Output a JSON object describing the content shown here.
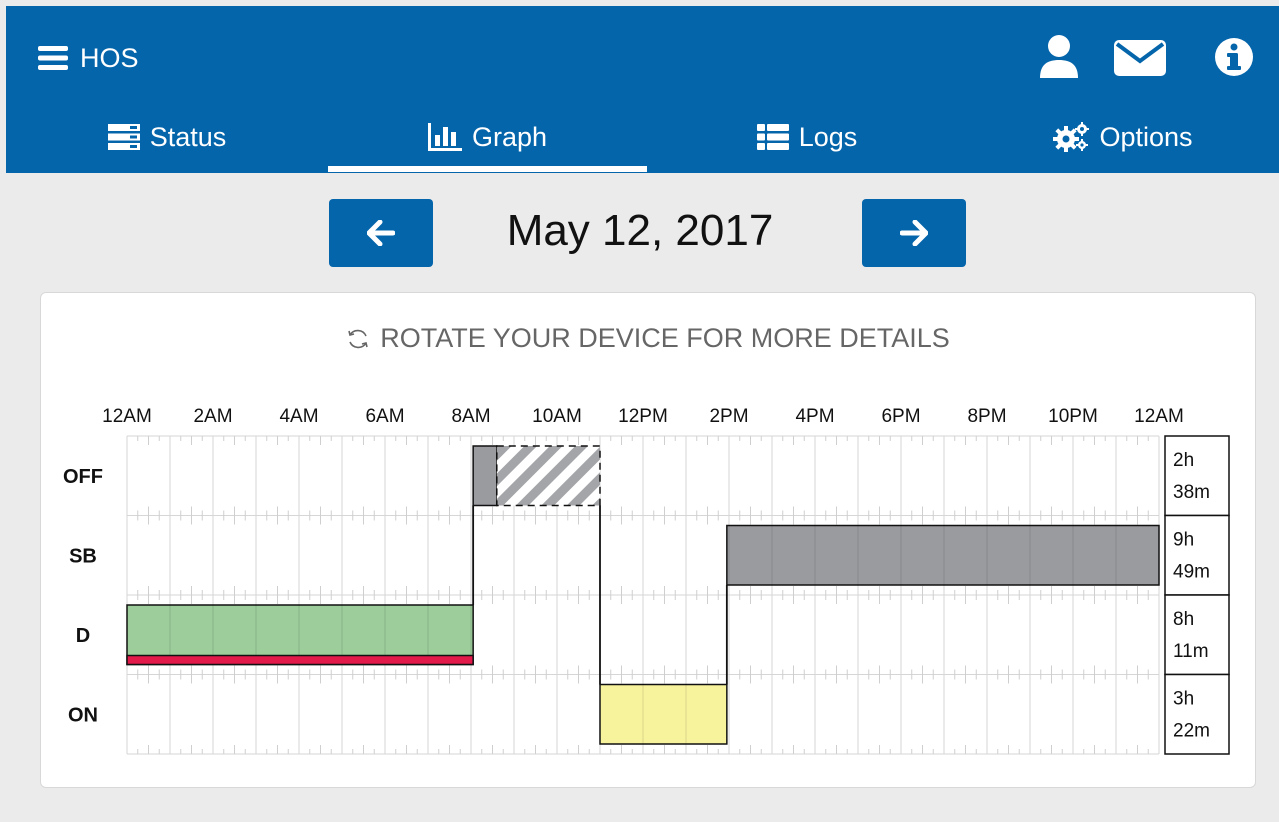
{
  "header": {
    "title": "HOS",
    "icons": {
      "menu": "bars-icon",
      "user": "user-icon",
      "mail": "envelope-icon",
      "info": "info-icon"
    }
  },
  "tabs": [
    {
      "label": "Status",
      "icon": "server-icon",
      "active": false
    },
    {
      "label": "Graph",
      "icon": "bar-chart-icon",
      "active": true
    },
    {
      "label": "Logs",
      "icon": "list-icon",
      "active": false
    },
    {
      "label": "Options",
      "icon": "cogs-icon",
      "active": false
    }
  ],
  "date_nav": {
    "date": "May 12, 2017",
    "prev_icon": "arrow-left-icon",
    "next_icon": "arrow-right-icon"
  },
  "notice": "ROTATE YOUR DEVICE FOR MORE DETAILS",
  "colors": {
    "brand": "#0565ab",
    "off": "#9a9b9f",
    "sb": "#9a9b9f",
    "driving": "#9ccd9a",
    "driving_violation": "#e2194b",
    "on_duty": "#f7f39d"
  },
  "chart_data": {
    "type": "table",
    "x_unit": "hours",
    "xlim": [
      0,
      24
    ],
    "x_tick_labels": [
      "12AM",
      "2AM",
      "4AM",
      "6AM",
      "8AM",
      "10AM",
      "12PM",
      "2PM",
      "4PM",
      "6PM",
      "8PM",
      "10PM",
      "12AM"
    ],
    "rows": [
      {
        "code": "OFF",
        "total": [
          "2h",
          "38m"
        ]
      },
      {
        "code": "SB",
        "total": [
          "9h",
          "49m"
        ]
      },
      {
        "code": "D",
        "total": [
          "8h",
          "11m"
        ]
      },
      {
        "code": "ON",
        "total": [
          "3h",
          "22m"
        ]
      }
    ],
    "segments": [
      {
        "status": "D",
        "start": 0,
        "end": 8.05
      },
      {
        "status": "OFF",
        "start": 8.05,
        "end": 8.6
      },
      {
        "status": "OFF",
        "start": 8.6,
        "end": 11.0,
        "style": "hatched"
      },
      {
        "status": "ON",
        "start": 11.0,
        "end": 13.95
      },
      {
        "status": "SB",
        "start": 13.95,
        "end": 24
      }
    ],
    "violations": [
      {
        "status": "D",
        "start": 0,
        "end": 8.05
      }
    ]
  }
}
